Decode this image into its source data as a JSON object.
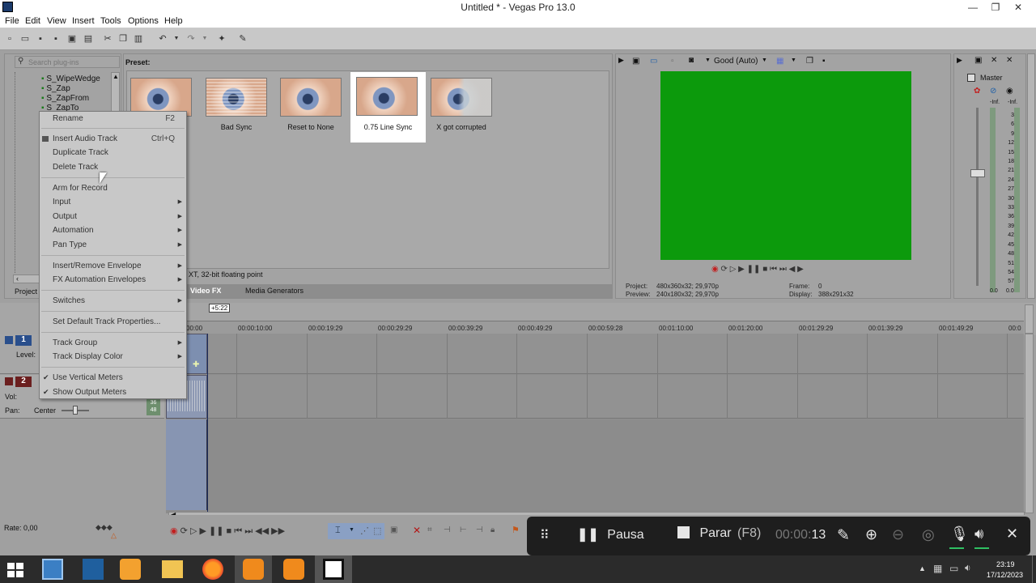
{
  "window": {
    "title": "Untitled * - Vegas Pro 13.0",
    "minimize": "—",
    "restore": "❐",
    "close": "✕"
  },
  "menubar": [
    "File",
    "Edit",
    "View",
    "Insert",
    "Tools",
    "Options",
    "Help"
  ],
  "explorer": {
    "search_placeholder": "Search plug-ins",
    "items": [
      "S_WipeWedge",
      "S_Zap",
      "S_ZapFrom",
      "S_ZapTo"
    ]
  },
  "presets": {
    "label": "Preset:",
    "items": [
      {
        "name": "Bad Sync"
      },
      {
        "name": "Reset to None"
      },
      {
        "name": "0.75 Line Sync"
      },
      {
        "name": "X got corrupted"
      }
    ],
    "selected": "0.75 Line Sync",
    "info": "XT, 32-bit floating point"
  },
  "tabs": {
    "project": "Project",
    "video_fx": "Video FX",
    "media_generators": "Media Generators"
  },
  "preview": {
    "quality": "Good (Auto)",
    "project_label": "Project:",
    "project_value": "480x360x32; 29,970p",
    "preview_label": "Preview:",
    "preview_value": "240x180x32; 29,970p",
    "frame_label": "Frame:",
    "frame_value": "0",
    "display_label": "Display:",
    "display_value": "388x291x32",
    "color": "#0c9a0c"
  },
  "master": {
    "label": "Master",
    "inf_left": "-Inf.",
    "inf_right": "-Inf.",
    "scale": [
      "3",
      "6",
      "9",
      "12",
      "15",
      "18",
      "21",
      "24",
      "27",
      "30",
      "33",
      "36",
      "39",
      "42",
      "45",
      "48",
      "51",
      "54",
      "57"
    ],
    "bottom_left": "0.0",
    "bottom_right": "0.0"
  },
  "timeline": {
    "position_marker": "+5:22",
    "ruler_start": "00:00",
    "ruler": [
      "00:00:10:00",
      "00:00:19:29",
      "00:00:29:29",
      "00:00:39:29",
      "00:00:49:29",
      "00:00:59:28",
      "00:01:10:00",
      "00:01:20:00",
      "00:01:29:29",
      "00:01:39:29",
      "00:01:49:29",
      "00:0"
    ]
  },
  "tracks": [
    {
      "num": "1",
      "label": "Level:"
    },
    {
      "num": "2",
      "vol": "Vol:",
      "pan": "Pan:",
      "pan_value": "Center",
      "meter_top": "36",
      "meter_bottom": "48"
    }
  ],
  "context_menu": {
    "rename": "Rename",
    "rename_sc": "F2",
    "insert_audio": "Insert Audio Track",
    "insert_audio_sc": "Ctrl+Q",
    "duplicate": "Duplicate Track",
    "delete": "Delete Track",
    "arm": "Arm for Record",
    "input": "Input",
    "output": "Output",
    "automation": "Automation",
    "pan_type": "Pan Type",
    "insert_remove_env": "Insert/Remove Envelope",
    "fx_auto_env": "FX Automation Envelopes",
    "switches": "Switches",
    "set_default": "Set Default Track Properties...",
    "track_group": "Track Group",
    "track_color": "Track Display Color",
    "vertical_meters": "Use Vertical Meters",
    "output_meters": "Show Output Meters"
  },
  "status": {
    "rate": "Rate: 0,00"
  },
  "recorder": {
    "pause": "Pausa",
    "stop": "Parar",
    "stop_key": "(F8)",
    "time_dim": "00:00:",
    "time_sec": "13"
  },
  "taskbar": {
    "time": "23:19",
    "date": "17/12/2023"
  }
}
